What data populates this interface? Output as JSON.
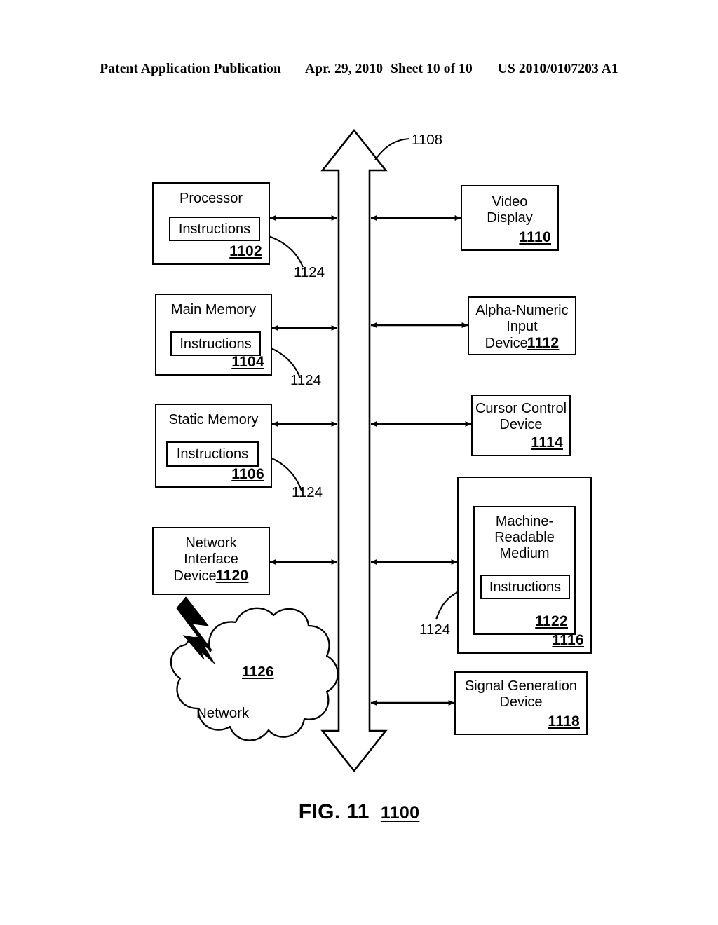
{
  "header": {
    "publication": "Patent Application Publication",
    "date": "Apr. 29, 2010",
    "sheet": "Sheet 10 of 10",
    "patent_number": "US 2010/0107203 A1"
  },
  "figure": {
    "label": "FIG. 11",
    "ref": "1100"
  },
  "bus": {
    "name": "system-bus",
    "ref": "1108"
  },
  "left_column": [
    {
      "name": "processor",
      "title": "Processor",
      "inner_label": "Instructions",
      "ref": "1102",
      "leader_ref": "1124"
    },
    {
      "name": "main-memory",
      "title": "Main Memory",
      "inner_label": "Instructions",
      "ref": "1104",
      "leader_ref": "1124"
    },
    {
      "name": "static-memory",
      "title": "Static Memory",
      "inner_label": "Instructions",
      "ref": "1106",
      "leader_ref": "1124"
    },
    {
      "name": "network-interface-device",
      "title": "Network\nInterface\nDevice",
      "ref": "1120"
    }
  ],
  "right_column": [
    {
      "name": "video-display",
      "title": "Video\nDisplay",
      "ref": "1110"
    },
    {
      "name": "alpha-numeric-input-device",
      "title": "Alpha-Numeric\nInput\nDevice",
      "ref": "1112"
    },
    {
      "name": "cursor-control-device",
      "title": "Cursor Control\nDevice",
      "ref": "1114"
    },
    {
      "name": "drive-unit",
      "title": "",
      "ref": "1116",
      "inner": {
        "name": "machine-readable-medium",
        "title": "Machine-\nReadable\nMedium",
        "inner_label": "Instructions",
        "ref": "1122",
        "leader_ref": "1124"
      }
    },
    {
      "name": "signal-generation-device",
      "title": "Signal Generation\nDevice",
      "ref": "1118"
    }
  ],
  "network": {
    "name": "network-cloud",
    "label": "Network",
    "ref": "1126"
  }
}
